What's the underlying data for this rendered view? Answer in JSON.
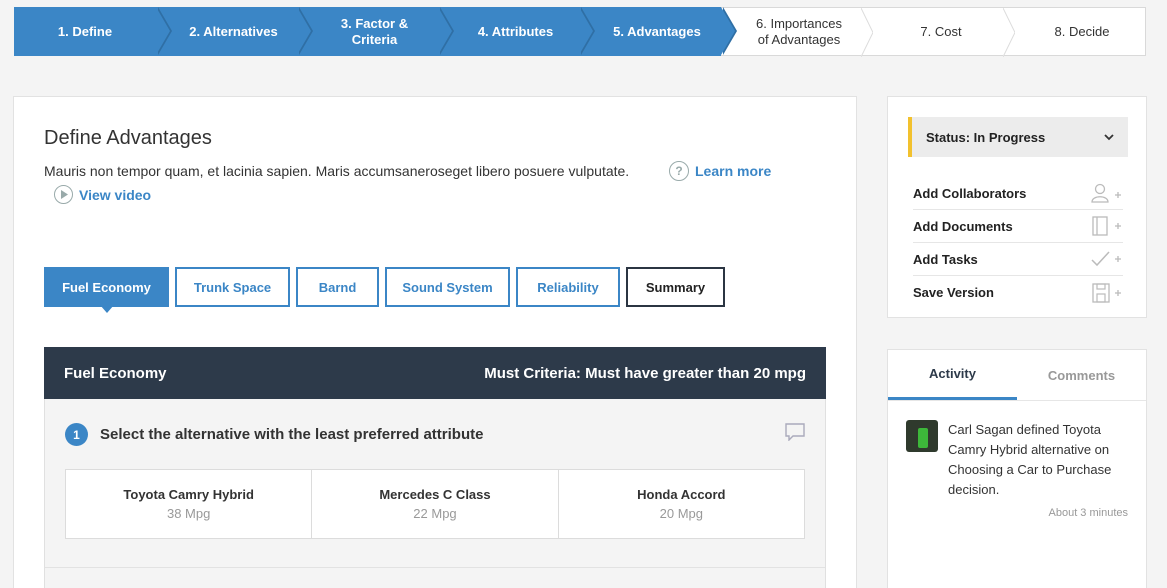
{
  "steps": [
    {
      "label": "1. Define",
      "state": "done"
    },
    {
      "label": "2. Alternatives",
      "state": "done"
    },
    {
      "label": "3. Factor &\nCriteria",
      "state": "done"
    },
    {
      "label": "4. Attributes",
      "state": "done"
    },
    {
      "label": "5. Advantages",
      "state": "done"
    },
    {
      "label": "6. Importances\nof Advantages",
      "state": "todo"
    },
    {
      "label": "7. Cost",
      "state": "todo"
    },
    {
      "label": "8. Decide",
      "state": "todo"
    }
  ],
  "main": {
    "title": "Define Advantages",
    "description": "Mauris non tempor quam, et lacinia sapien. Maris accumsaneroseget libero posuere vulputate.",
    "learn_more": "Learn more",
    "view_video": "View video",
    "tabs": [
      "Fuel Economy",
      "Trunk Space",
      "Barnd",
      "Sound System",
      "Reliability",
      "Summary"
    ],
    "criterion": {
      "name": "Fuel Economy",
      "must": "Must Criteria: Must have greater than 20 mpg"
    },
    "question": {
      "number": "1",
      "text": "Select the alternative with the least preferred attribute"
    },
    "alternatives": [
      {
        "name": "Toyota Camry Hybrid",
        "value": "38 Mpg"
      },
      {
        "name": "Mercedes C Class",
        "value": "22 Mpg"
      },
      {
        "name": "Honda Accord",
        "value": "20 Mpg"
      }
    ]
  },
  "sidebar": {
    "status": "Status: In Progress",
    "actions": [
      {
        "label": "Add Collaborators",
        "icon": "add-user-icon"
      },
      {
        "label": "Add Documents",
        "icon": "add-document-icon"
      },
      {
        "label": "Add Tasks",
        "icon": "add-task-icon"
      },
      {
        "label": "Save Version",
        "icon": "save-icon"
      }
    ],
    "tabs": [
      "Activity",
      "Comments"
    ],
    "activity": {
      "text": "Carl Sagan defined Toyota Camry Hybrid alternative on Choosing a Car to Purchase decision.",
      "time": "About 3 minutes"
    }
  },
  "colors": {
    "accent": "#3b86c6",
    "dark": "#2d3a4a",
    "status": "#f2c12e"
  }
}
